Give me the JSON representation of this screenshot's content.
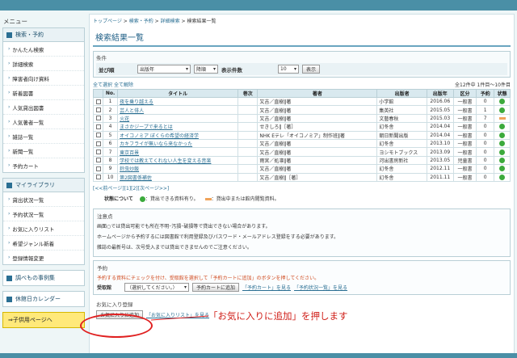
{
  "sidebar": {
    "title": "メニュー",
    "search_group": {
      "head": "検索・予約",
      "items": [
        "かんたん検索",
        "詳細検索",
        "障害者向け資料",
        "新着図書",
        "人気貸出図書",
        "人気著者一覧",
        "雑誌一覧",
        "新聞一覧",
        "予約カート"
      ]
    },
    "library_group": {
      "head": "マイライブラリ",
      "items": [
        "貸出状況一覧",
        "予約状況一覧",
        "お気に入りリスト",
        "希望ジャンル新着",
        "登録情報変更"
      ]
    },
    "cases": "調べもの事例集",
    "calendar": "休館日カレンダー",
    "kids": "⇒子供用ページへ"
  },
  "breadcrumb": [
    "トップページ",
    "検索・予約",
    "詳細検索",
    "検索結果一覧"
  ],
  "page_title": "検索結果一覧",
  "conditions": {
    "label": "条件",
    "sort_label": "並び順",
    "sort_value": "出版年",
    "order_value": "降順",
    "per_page_label": "表示件数",
    "per_page_value": "10",
    "show_button": "表示"
  },
  "select_all": "全て選択",
  "deselect_all": "全て解除",
  "result_count": "全12件中 1件目〜10件目",
  "table": {
    "headers": [
      "No.",
      "タイトル",
      "巻次",
      "著者",
      "出版者",
      "出版年",
      "区分",
      "予約",
      "状態"
    ],
    "rows": [
      {
        "no": "1",
        "title": "夜を乗り越える",
        "vol": "",
        "author": "又吉／直樹‖著",
        "pub": "小学館",
        "year": "2016.06",
        "cat": "一般書",
        "resv": "0",
        "status": "ok"
      },
      {
        "no": "2",
        "title": "芸人と俳人",
        "vol": "",
        "author": "又吉／直樹‖著",
        "pub": "集英社",
        "year": "2015.05",
        "cat": "一般書",
        "resv": "1",
        "status": "ok"
      },
      {
        "no": "3",
        "title": "火花",
        "vol": "",
        "author": "又吉／直樹‖著",
        "pub": "文藝春秋",
        "year": "2015.03",
        "cat": "一般書",
        "resv": "7",
        "status": "ng"
      },
      {
        "no": "4",
        "title": "まさかジープで来るとは",
        "vol": "",
        "author": "せきしろ‖［著］",
        "pub": "幻冬舎",
        "year": "2014.04",
        "cat": "一般書",
        "resv": "0",
        "status": "ok"
      },
      {
        "no": "5",
        "title": "オイコノミア ぼくらの希望の経済学",
        "vol": "",
        "author": "NHK Eテレ「オイコノミア」制作班‖著",
        "pub": "朝日新聞出版",
        "year": "2014.04",
        "cat": "一般書",
        "resv": "0",
        "status": "ok"
      },
      {
        "no": "6",
        "title": "カキフライが無いなら来なかった",
        "vol": "",
        "author": "又吉／直樹‖著",
        "pub": "幻冬舎",
        "year": "2013.10",
        "cat": "一般書",
        "resv": "0",
        "status": "ok"
      },
      {
        "no": "7",
        "title": "東京百景",
        "vol": "",
        "author": "又吉／直樹‖著",
        "pub": "ヨシモトブックス",
        "year": "2013.09",
        "cat": "一般書",
        "resv": "0",
        "status": "ok"
      },
      {
        "no": "8",
        "title": "学校では教えてくれない人生を変える音楽",
        "vol": "",
        "author": "雨宮／処凛‖著",
        "pub": "河出書房新社",
        "year": "2013.05",
        "cat": "児童書",
        "resv": "0",
        "status": "ok"
      },
      {
        "no": "9",
        "title": "鈴虫炒飯",
        "vol": "",
        "author": "又吉／直樹‖著",
        "pub": "幻冬舎",
        "year": "2012.11",
        "cat": "一般書",
        "resv": "0",
        "status": "ok"
      },
      {
        "no": "10",
        "title": "第2図書係補佐",
        "vol": "",
        "author": "又吉／直樹‖［著］",
        "pub": "幻冬舎",
        "year": "2011.11",
        "cat": "一般書",
        "resv": "0",
        "status": "ok"
      }
    ]
  },
  "pager": "[<<前ページ][1][2][次ページ>>]",
  "legend": {
    "label": "状態について",
    "ok": "：貸出できる資料有り。",
    "ng": "：貸出中または館内閲覧資料。"
  },
  "notes": {
    "title": "注意点",
    "lines": [
      "画面○では貸出可能でも所在不明･汚損･破損等で貸出できない場合があります。",
      "ホームページから予約するには図書館で利用登録及びパスワード・メールアドレス登録をする必要があります。",
      "雑誌の最新号は、次号受入までは貸出できませんのでご注意ください。"
    ]
  },
  "reserve": {
    "title": "予約",
    "note": "予約する資料にチェックを付け、受取館を選択して「予約カートに追加」のボタンを押してください。",
    "pickup_label": "受取館",
    "pickup_value": "（選択してください。）",
    "add_cart_button": "予約カートに追加",
    "view_cart_link": "「予約カート」を見る",
    "view_status_link": "「予約状況一覧」を見る"
  },
  "favorites": {
    "title": "お気に入り登録",
    "add_button": "お気に入りに追加",
    "view_link": "「お気に入りリスト」を見る"
  },
  "callout": "「お気に入りに追加」を押します"
}
